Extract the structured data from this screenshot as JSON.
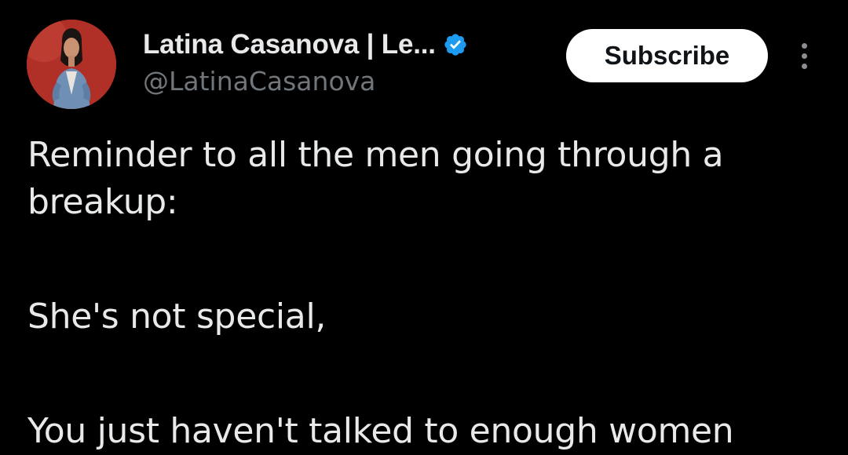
{
  "author": {
    "display_name": "Latina Casanova | Le...",
    "handle": "@LatinaCasanova",
    "verified": true,
    "avatar_icon": "profile-photo"
  },
  "actions": {
    "subscribe_label": "Subscribe",
    "more_icon": "vertical-ellipsis-icon"
  },
  "tweet": {
    "paragraphs": [
      "Reminder to all the men going through a breakup:",
      "She's not special,",
      "You just haven't talked to enough women"
    ]
  },
  "colors": {
    "background": "#000000",
    "primary_text": "#e7e9ea",
    "secondary_text": "#71767b",
    "verified_blue": "#1d9bf0",
    "button_bg": "#ffffff"
  }
}
